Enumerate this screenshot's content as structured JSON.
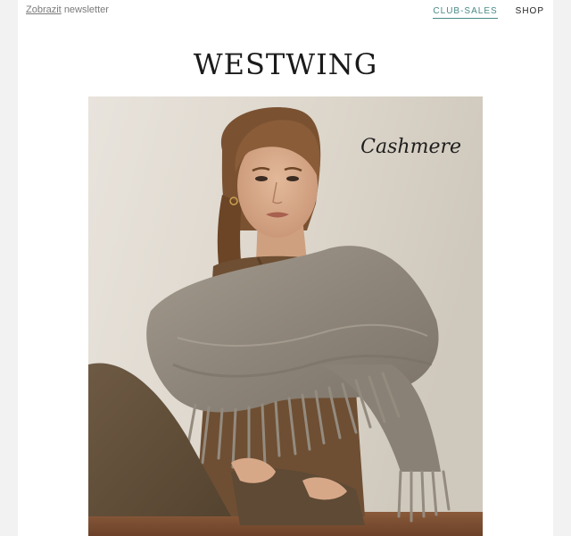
{
  "preheader": {
    "link_text": "Zobrazit",
    "suffix_text": "newsletter"
  },
  "nav": {
    "club_sales": "CLUB-SALES",
    "shop": "SHOP"
  },
  "brand": {
    "logo": "WESTWING"
  },
  "hero": {
    "caption": "Cashmere",
    "image": "woman-in-cashmere-scarf-photo"
  },
  "colors": {
    "accent": "#4a8a87",
    "background": "#ffffff",
    "page_bg": "#f2f2f2"
  }
}
